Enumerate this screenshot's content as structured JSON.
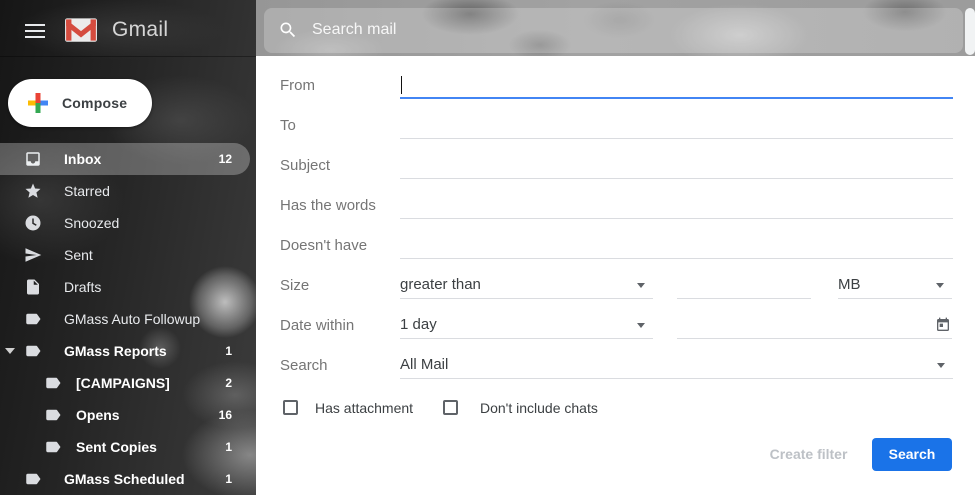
{
  "header": {
    "brand": "Gmail",
    "search_placeholder": "Search mail"
  },
  "sidebar": {
    "compose_label": "Compose",
    "items": [
      {
        "label": "Inbox",
        "count": "12",
        "icon": "inbox",
        "selected": true
      },
      {
        "label": "Starred",
        "count": "",
        "icon": "star"
      },
      {
        "label": "Snoozed",
        "count": "",
        "icon": "clock"
      },
      {
        "label": "Sent",
        "count": "",
        "icon": "send"
      },
      {
        "label": "Drafts",
        "count": "",
        "icon": "draft"
      },
      {
        "label": "GMass Auto Followup",
        "count": "",
        "icon": "label"
      },
      {
        "label": "GMass Reports",
        "count": "1",
        "icon": "label",
        "expandable": true
      },
      {
        "label": "[CAMPAIGNS]",
        "count": "2",
        "icon": "label",
        "indent": 1
      },
      {
        "label": "Opens",
        "count": "16",
        "icon": "label",
        "indent": 1
      },
      {
        "label": "Sent Copies",
        "count": "1",
        "icon": "label",
        "indent": 1
      },
      {
        "label": "GMass Scheduled",
        "count": "1",
        "icon": "label"
      }
    ]
  },
  "filter_panel": {
    "text_fields": [
      {
        "label": "From",
        "value": "",
        "focused": true
      },
      {
        "label": "To",
        "value": ""
      },
      {
        "label": "Subject",
        "value": ""
      },
      {
        "label": "Has the words",
        "value": ""
      },
      {
        "label": "Doesn't have",
        "value": ""
      }
    ],
    "size_row": {
      "label": "Size",
      "comparator": "greater than",
      "value": "",
      "unit": "MB"
    },
    "date_row": {
      "label": "Date within",
      "range": "1 day",
      "date_value": ""
    },
    "scope_row": {
      "label": "Search",
      "value": "All Mail"
    },
    "checkboxes": [
      {
        "label": "Has attachment",
        "checked": false
      },
      {
        "label": "Don't include chats",
        "checked": false
      }
    ],
    "actions": {
      "create_filter": "Create filter",
      "search": "Search"
    }
  },
  "colors": {
    "accent_blue": "#1a73e8",
    "focused_underline": "#4285f4",
    "disabled_text": "#bdc1c6",
    "gmail_red": "#d54c3f"
  }
}
